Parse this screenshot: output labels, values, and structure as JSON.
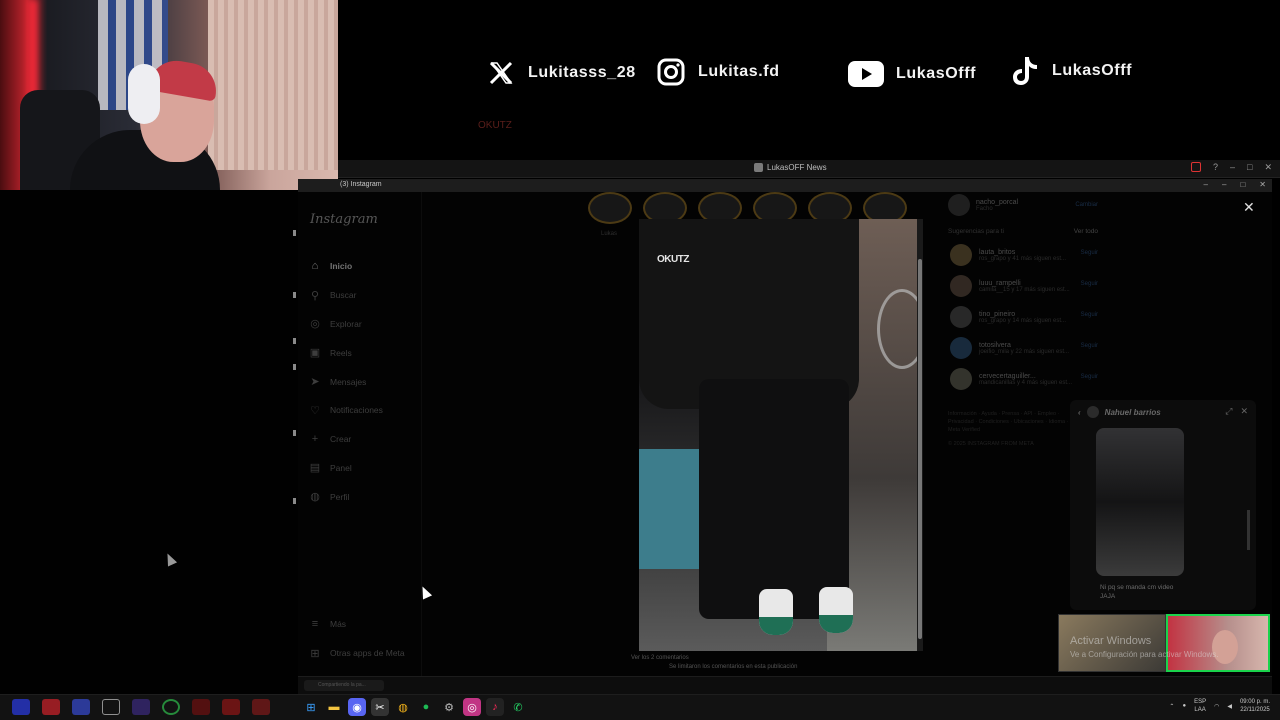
{
  "socials": [
    {
      "icon": "x-icon",
      "handle": "Lukitasss_28"
    },
    {
      "icon": "instagram-icon",
      "handle": "Lukitas.fd"
    },
    {
      "icon": "youtube-icon",
      "handle": "LukasOfff"
    },
    {
      "icon": "tiktok-icon",
      "handle": "LukasOfff"
    }
  ],
  "faint_text": "OKUTZ",
  "app_window": {
    "title": "LukasOFF News"
  },
  "instagram_window": {
    "title": "(3) Instagram"
  },
  "sidebar": {
    "brand": "Instagram",
    "items": [
      {
        "label": "Inicio",
        "icon": "home-icon",
        "active": true
      },
      {
        "label": "Buscar",
        "icon": "search-icon"
      },
      {
        "label": "Explorar",
        "icon": "compass-icon"
      },
      {
        "label": "Reels",
        "icon": "reels-icon"
      },
      {
        "label": "Mensajes",
        "icon": "messages-icon"
      },
      {
        "label": "Notificaciones",
        "icon": "heart-icon"
      },
      {
        "label": "Crear",
        "icon": "plus-icon"
      },
      {
        "label": "Panel",
        "icon": "dashboard-icon"
      },
      {
        "label": "Perfil",
        "icon": "profile-icon"
      }
    ],
    "bottom": [
      {
        "label": "Más",
        "icon": "menu-icon"
      },
      {
        "label": "Otras apps de Meta",
        "icon": "meta-icon"
      }
    ]
  },
  "stories": {
    "first_label": "Lukas"
  },
  "post": {
    "shirt_logo": "OKUTZ"
  },
  "comments": {
    "view": "Ver los 2 comentarios",
    "limited": "Se limitaron los comentarios en esta publicación"
  },
  "profile": {
    "username": "nacho_porcal",
    "name": "Facho",
    "switch_label": "Cambiar"
  },
  "suggestions": {
    "header": "Sugerencias para ti",
    "see_all": "Ver todo",
    "follow_label": "Seguir",
    "users": [
      {
        "username": "lauta_britos",
        "sub": "ros_grapo y 41 más siguen est..."
      },
      {
        "username": "luuu_rampelli",
        "sub": "camila__15 y 17 más siguen est..."
      },
      {
        "username": "tino_pineiro",
        "sub": "ros_grapo y 14 más siguen est..."
      },
      {
        "username": "totosilvera",
        "sub": "joeifio_mila y 22 más siguen est..."
      },
      {
        "username": "cervecertaguiller...",
        "sub": "mandicanillas y 4 más siguen est..."
      }
    ]
  },
  "footer": {
    "links": "Información · Ayuda · Prensa · API · Empleo · Privacidad · Condiciones · Ubicaciones · Idioma · Meta Verified",
    "copyright": "© 2025 INSTAGRAM FROM META"
  },
  "chat": {
    "name": "Nahuel barrios",
    "message": "Ni pq se manda cm video",
    "message2": "JAJA"
  },
  "watermark": {
    "title": "Activar Windows",
    "subtitle": "Ve a Configuración para activar Windows."
  },
  "taskbar": {
    "pill": "Compartiendo la pa...",
    "lang1": "ESP",
    "lang2": "LAA",
    "time": "09:00 p. m.",
    "date": "22/11/2025"
  }
}
